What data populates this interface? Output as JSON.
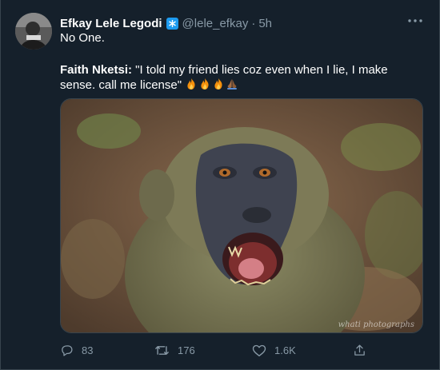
{
  "author": {
    "display_name": "Efkay Lele Legodi",
    "handle": "@lele_efkay",
    "separator": "·",
    "time": "5h"
  },
  "tweet": {
    "line1": "No One.",
    "quote_author": "Faith Nketsi:",
    "quote_text": " \"I told my friend lies coz even when I lie, I make sense. call me license\""
  },
  "media": {
    "watermark": "whati photographs"
  },
  "actions": {
    "replies": "83",
    "retweets": "176",
    "likes": "1.6K"
  },
  "colors": {
    "background": "#15202b",
    "secondary_text": "#8899a6",
    "verified": "#1d9bf0",
    "divider": "#38444d"
  },
  "icons": [
    "more-icon",
    "verified-badge-icon",
    "reply-icon",
    "retweet-icon",
    "like-icon",
    "share-icon",
    "fire-emoji",
    "praying-hands-emoji"
  ]
}
